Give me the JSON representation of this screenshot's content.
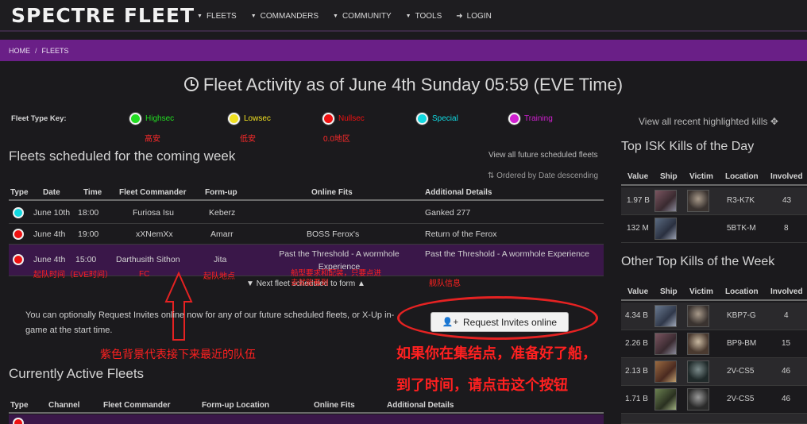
{
  "nav": {
    "logo": "SPECTRE FLEET",
    "items": [
      "FLEETS",
      "COMMANDERS",
      "COMMUNITY",
      "TOOLS"
    ],
    "login": "LOGIN"
  },
  "breadcrumb": [
    "HOME",
    "FLEETS"
  ],
  "title": "Fleet Activity as of June 4th Sunday 05:59 (EVE Time)",
  "fleet_key": {
    "label": "Fleet Type Key:",
    "types": [
      {
        "label": "Highsec",
        "color": "#22dd22",
        "note": "高安"
      },
      {
        "label": "Lowsec",
        "color": "#f0e020",
        "note": "低安"
      },
      {
        "label": "Nullsec",
        "color": "#ee1111",
        "note": "0.0地区"
      },
      {
        "label": "Special",
        "color": "#11d8e0",
        "note": ""
      },
      {
        "label": "Training",
        "color": "#d020d0",
        "note": ""
      }
    ]
  },
  "scheduled": {
    "heading": "Fleets scheduled for the coming week",
    "view_all": "View all future scheduled fleets",
    "sort_note": "Ordered by Date descending",
    "columns": [
      "Type",
      "Date",
      "Time",
      "Fleet Commander",
      "Form-up",
      "Online Fits",
      "Additional Details"
    ],
    "rows": [
      {
        "color": "#11d8e0",
        "date": "June 10th",
        "time": "18:00",
        "fc": "Furiosa Isu",
        "formup": "Keberz",
        "fits": "",
        "details": "Ganked 277"
      },
      {
        "color": "#ee1111",
        "date": "June 4th",
        "time": "19:00",
        "fc": "xXNemXx",
        "formup": "Amarr",
        "fits": "BOSS Ferox's",
        "details": "Return of the Ferox"
      },
      {
        "color": "#ee1111",
        "date": "June 4th",
        "time": "15:00",
        "fc": "Darthusith Sithon",
        "formup": "Jita",
        "fits": "Past the Threshold - A wormhole Experience",
        "details": "Past the Threshold - A wormhole Experience"
      }
    ],
    "next_fleet": "Next fleet scheduled to form"
  },
  "invite": {
    "text": "You can optionally Request Invites online now for any of our future scheduled fleets, or X-Up in-game at the start time.",
    "button": "Request Invites online"
  },
  "active": {
    "heading": "Currently Active Fleets",
    "columns": [
      "Type",
      "Channel",
      "Fleet Commander",
      "Form-up Location",
      "Online Fits",
      "Additional Details"
    ]
  },
  "annotations": {
    "time": "起队时间（EVE时间）",
    "fc": "FC",
    "formup": "起队地点",
    "fits": "船型要求和配装，只要点进去就能看到",
    "details": "舰队信息",
    "purple": "紫色背景代表接下来最近的队伍",
    "instr1": "如果你在集结点，准备好了船，",
    "instr2": "到了时间，请点击这个按钮"
  },
  "sidebar": {
    "view_all": "View all recent highlighted kills",
    "isk_day": {
      "heading": "Top ISK Kills of the Day",
      "columns": [
        "Value",
        "Ship",
        "Victim",
        "Location",
        "Involved"
      ],
      "rows": [
        {
          "value": "1.97 B",
          "location": "R3-K7K",
          "involved": "43"
        },
        {
          "value": "132 M",
          "location": "5BTK-M",
          "involved": "8"
        }
      ]
    },
    "week": {
      "heading": "Other Top Kills of the Week",
      "columns": [
        "Value",
        "Ship",
        "Victim",
        "Location",
        "Involved"
      ],
      "rows": [
        {
          "value": "4.34 B",
          "location": "KBP7-G",
          "involved": "4"
        },
        {
          "value": "2.26 B",
          "location": "BP9-BM",
          "involved": "15"
        },
        {
          "value": "2.13 B",
          "location": "2V-CS5",
          "involved": "46"
        },
        {
          "value": "1.71 B",
          "location": "2V-CS5",
          "involved": "46"
        }
      ]
    }
  }
}
